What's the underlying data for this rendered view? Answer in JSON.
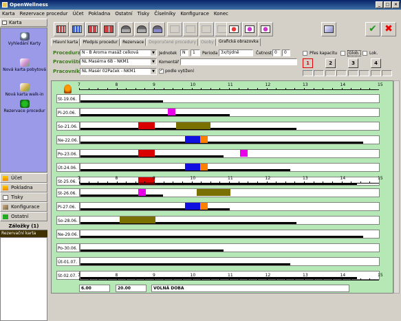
{
  "app": {
    "title": "OpenWellness"
  },
  "window_buttons": [
    "_",
    "□",
    "×"
  ],
  "menu": [
    "Karta",
    "Rezervace procedur",
    "Účet",
    "Pokladna",
    "Ostatní",
    "Tisky",
    "Číselníky",
    "Konfigurace",
    "Konec"
  ],
  "sidebar": {
    "header": "Karta",
    "items": [
      {
        "label": "Vyhledání Karty",
        "icon": "magnifier-icon"
      },
      {
        "label": "Nová karta pobytová",
        "icon": "new-card-icon"
      },
      {
        "label": "Nová karta walk-in",
        "icon": "walkin-card-icon"
      },
      {
        "label": "Rezervace procedur",
        "icon": "reservation-icon"
      }
    ],
    "nav": [
      {
        "label": "Účet",
        "icon": "lightning-icon"
      },
      {
        "label": "Pokladna",
        "icon": "lightning-icon"
      },
      {
        "label": "Tisky",
        "icon": "document-icon"
      },
      {
        "label": "Konfigurace",
        "icon": "tools-icon"
      },
      {
        "label": "Ostatní",
        "icon": "green-arrow-icon"
      }
    ],
    "bookmarks_header": "Záložky (1)",
    "bookmarks": [
      "Rezervační karta"
    ]
  },
  "tabs": [
    "Hlavní karta",
    "Předpis procedur",
    "Rezervace",
    "Doporučené procedury",
    "Osoby",
    "Grafická obrazovka"
  ],
  "form": {
    "procedura_label": "Procedura",
    "procedura_value": "N - B Aroma masáž celková",
    "pracoviste_label": "Pracoviště",
    "pracoviste_value": "NL Masérna 6B - NKM1",
    "pracovnik_label": "Pracovník",
    "pracovnik_value": "NL Masér 02Paček - NKM1",
    "jednotek_label": "Jednotek",
    "jednotek_unit": "N",
    "jednotek_value": "1",
    "perioda_label": "Perioda",
    "perioda_value": "3x/týdně",
    "cetnost_label": "Četnost",
    "cetnost_a": "0",
    "cetnost_b": "0",
    "komentar_label": "Komentář",
    "podle_label": "podle vytížení",
    "pres_kapacitu": "Přes kapacitu",
    "glob": "Glob.",
    "lok": "Lok.",
    "time_buttons": [
      "1",
      "2",
      "3",
      "4"
    ]
  },
  "ruler_labels": [
    "7",
    "8",
    "9",
    "10",
    "11",
    "12",
    "13",
    "14",
    "15"
  ],
  "week1": [
    {
      "day": "St-19.06.",
      "blocks": []
    },
    {
      "day": "Pi-20.06.",
      "blocks": [
        {
          "start": 9.33,
          "end": 9.53,
          "color": "#e800e8"
        }
      ]
    },
    {
      "day": "So-21.06.",
      "blocks": [
        {
          "start": 8.55,
          "end": 8.98,
          "color": "#d80000"
        },
        {
          "start": 9.55,
          "end": 10.47,
          "color": "#7a7000"
        }
      ]
    },
    {
      "day": "Ne-22.06.",
      "blocks": [
        {
          "start": 9.78,
          "end": 10.2,
          "color": "#1010e0"
        },
        {
          "start": 10.2,
          "end": 10.4,
          "color": "#ff8000"
        }
      ]
    },
    {
      "day": "Po-23.06.",
      "blocks": [
        {
          "start": 8.55,
          "end": 8.98,
          "color": "#d80000"
        },
        {
          "start": 11.25,
          "end": 11.45,
          "color": "#e800e8"
        }
      ]
    },
    {
      "day": "Út-24.06.",
      "blocks": [
        {
          "start": 9.78,
          "end": 10.2,
          "color": "#1010e0"
        },
        {
          "start": 10.2,
          "end": 10.4,
          "color": "#ff8000"
        }
      ]
    },
    {
      "day": "St-25.06.",
      "blocks": [
        {
          "start": 8.55,
          "end": 8.98,
          "color": "#d80000"
        }
      ]
    }
  ],
  "week2": [
    {
      "day": "St-26.06.",
      "blocks": [
        {
          "start": 8.55,
          "end": 8.75,
          "color": "#e800e8"
        },
        {
          "start": 10.1,
          "end": 11.0,
          "color": "#7a7000"
        }
      ]
    },
    {
      "day": "Pi-27.06.",
      "blocks": [
        {
          "start": 9.78,
          "end": 10.2,
          "color": "#1010e0"
        },
        {
          "start": 10.2,
          "end": 10.4,
          "color": "#ff8000"
        }
      ]
    },
    {
      "day": "So-28.06.",
      "blocks": [
        {
          "start": 8.05,
          "end": 9.0,
          "color": "#7a7000"
        }
      ]
    },
    {
      "day": "Ne-29.06.",
      "blocks": []
    },
    {
      "day": "Po-30.06.",
      "blocks": []
    },
    {
      "day": "Út-01.07.",
      "blocks": []
    },
    {
      "day": "St-02.07.",
      "blocks": []
    }
  ],
  "footer": {
    "from": "6.00",
    "to": "20.00",
    "label": "VOLNÁ DOBA"
  }
}
